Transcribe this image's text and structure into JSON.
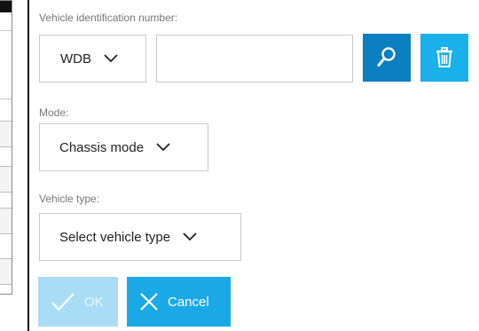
{
  "vin": {
    "label": "Vehicle identification number:",
    "prefix_selected": "WDB",
    "value": "",
    "placeholder": ""
  },
  "mode": {
    "label": "Mode:",
    "selected": "Chassis mode"
  },
  "vehicle_type": {
    "label": "Vehicle type:",
    "selected": "Select vehicle type"
  },
  "buttons": {
    "ok_label": "OK",
    "cancel_label": "Cancel"
  },
  "colors": {
    "search_button": "#0b7fbf",
    "delete_button": "#1ab0ea",
    "ok_button_disabled": "#a9dcf5",
    "cancel_button": "#1aa9e6"
  },
  "icons": {
    "search": "search-icon",
    "delete": "trash-icon",
    "ok": "check-icon",
    "cancel": "close-icon",
    "dropdown": "chevron-down-icon"
  }
}
